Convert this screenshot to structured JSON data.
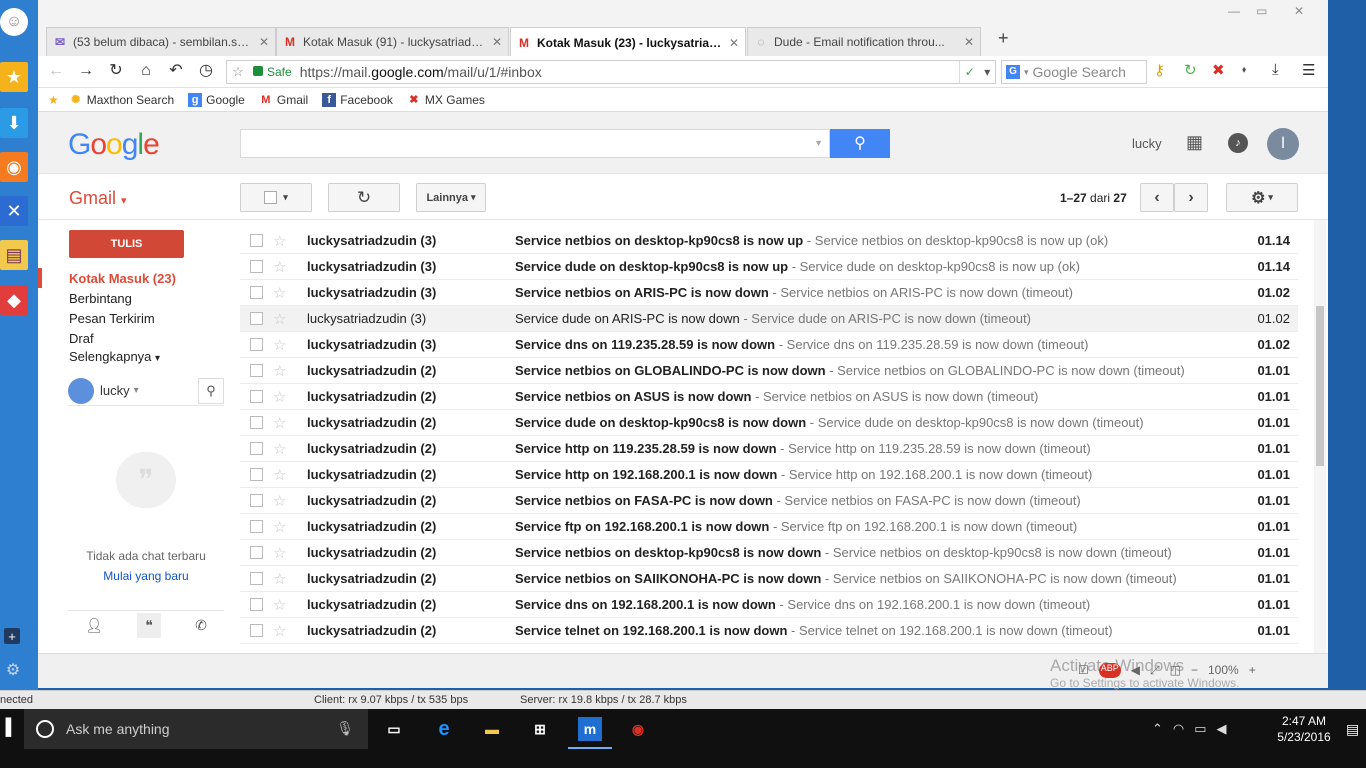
{
  "sidebar": {
    "icons": [
      "smiley-icon",
      "favorites-star-icon",
      "download-icon",
      "rss-icon",
      "tools-icon",
      "notes-icon",
      "games-icon",
      "add-icon",
      "settings-gear-icon"
    ]
  },
  "tabs": [
    {
      "label": "(53 belum dibaca) - sembilan.sut...",
      "icon": "mail-icon",
      "active": false
    },
    {
      "label": "Kotak Masuk (91) - luckysatriadz...",
      "icon": "gmail-icon",
      "active": false
    },
    {
      "label": "Kotak Masuk (23) - luckysatria1...",
      "icon": "gmail-icon",
      "active": true
    },
    {
      "label": "Dude - Email notification throu...",
      "icon": "page-icon",
      "active": false
    }
  ],
  "nav": {
    "safe_label": "Safe",
    "url_prefix": "https://mail.",
    "url_domain": "google.com",
    "url_suffix": "/mail/u/1/#inbox",
    "search_placeholder": "Google Search"
  },
  "bookmarks": [
    {
      "label": "Maxthon Search",
      "icon": "maxthon-icon",
      "color": "#f6b21a"
    },
    {
      "label": "Google",
      "icon": "google-icon",
      "color": "#4285f4"
    },
    {
      "label": "Gmail",
      "icon": "gmail-icon",
      "color": "#d93025"
    },
    {
      "label": "Facebook",
      "icon": "facebook-icon",
      "color": "#3b5998"
    },
    {
      "label": "MX Games",
      "icon": "mx-games-icon",
      "color": "#d93025"
    }
  ],
  "gmail": {
    "logo": [
      "G",
      "o",
      "o",
      "g",
      "l",
      "e"
    ],
    "user_name": "lucky",
    "avatar_letter": "l",
    "brand": "Gmail",
    "more_button": "Lainnya",
    "pager_range": "1–27",
    "pager_of": "dari",
    "pager_total": "27",
    "compose": "TULIS",
    "nav": [
      {
        "label": "Kotak Masuk (23)",
        "active": true
      },
      {
        "label": "Berbintang",
        "active": false
      },
      {
        "label": "Pesan Terkirim",
        "active": false
      },
      {
        "label": "Draf",
        "active": false
      },
      {
        "label": "Selengkapnya",
        "active": false
      }
    ],
    "hangouts_user": "lucky",
    "no_chat": "Tidak ada chat terbaru",
    "start_new": "Mulai yang baru",
    "emails": [
      {
        "sender": "luckysatriadzudin (3)",
        "subject": "Service netbios on desktop-kp90cs8 is now up",
        "snippet": " - Service netbios on desktop-kp90cs8 is now up (ok)",
        "date": "01.14",
        "read": false
      },
      {
        "sender": "luckysatriadzudin (3)",
        "subject": "Service dude on desktop-kp90cs8 is now up",
        "snippet": " - Service dude on desktop-kp90cs8 is now up (ok)",
        "date": "01.14",
        "read": false
      },
      {
        "sender": "luckysatriadzudin (3)",
        "subject": "Service netbios on ARIS-PC is now down",
        "snippet": " - Service netbios on ARIS-PC is now down (timeout)",
        "date": "01.02",
        "read": false
      },
      {
        "sender": "luckysatriadzudin (3)",
        "subject": "Service dude on ARIS-PC is now down",
        "snippet": " - Service dude on ARIS-PC is now down (timeout)",
        "date": "01.02",
        "read": true
      },
      {
        "sender": "luckysatriadzudin (3)",
        "subject": "Service dns on 119.235.28.59 is now down",
        "snippet": " - Service dns on 119.235.28.59 is now down (timeout)",
        "date": "01.02",
        "read": false
      },
      {
        "sender": "luckysatriadzudin (2)",
        "subject": "Service netbios on GLOBALINDO-PC is now down",
        "snippet": " - Service netbios on GLOBALINDO-PC is now down (timeout)",
        "date": "01.01",
        "read": false
      },
      {
        "sender": "luckysatriadzudin (2)",
        "subject": "Service netbios on ASUS is now down",
        "snippet": " - Service netbios on ASUS is now down (timeout)",
        "date": "01.01",
        "read": false
      },
      {
        "sender": "luckysatriadzudin (2)",
        "subject": "Service dude on desktop-kp90cs8 is now down",
        "snippet": " - Service dude on desktop-kp90cs8 is now down (timeout)",
        "date": "01.01",
        "read": false
      },
      {
        "sender": "luckysatriadzudin (2)",
        "subject": "Service http on 119.235.28.59 is now down",
        "snippet": " - Service http on 119.235.28.59 is now down (timeout)",
        "date": "01.01",
        "read": false
      },
      {
        "sender": "luckysatriadzudin (2)",
        "subject": "Service http on 192.168.200.1 is now down",
        "snippet": " - Service http on 192.168.200.1 is now down (timeout)",
        "date": "01.01",
        "read": false
      },
      {
        "sender": "luckysatriadzudin (2)",
        "subject": "Service netbios on FASA-PC is now down",
        "snippet": " - Service netbios on FASA-PC is now down (timeout)",
        "date": "01.01",
        "read": false
      },
      {
        "sender": "luckysatriadzudin (2)",
        "subject": "Service ftp on 192.168.200.1 is now down",
        "snippet": " - Service ftp on 192.168.200.1 is now down (timeout)",
        "date": "01.01",
        "read": false
      },
      {
        "sender": "luckysatriadzudin (2)",
        "subject": "Service netbios on desktop-kp90cs8 is now down",
        "snippet": " - Service netbios on desktop-kp90cs8 is now down (timeout)",
        "date": "01.01",
        "read": false
      },
      {
        "sender": "luckysatriadzudin (2)",
        "subject": "Service netbios on SAIIKONOHA-PC is now down",
        "snippet": " - Service netbios on SAIIKONOHA-PC is now down (timeout)",
        "date": "01.01",
        "read": false
      },
      {
        "sender": "luckysatriadzudin (2)",
        "subject": "Service dns on 192.168.200.1 is now down",
        "snippet": " - Service dns on 192.168.200.1 is now down (timeout)",
        "date": "01.01",
        "read": false
      },
      {
        "sender": "luckysatriadzudin (2)",
        "subject": "Service telnet on 192.168.200.1 is now down",
        "snippet": " - Service telnet on 192.168.200.1 is now down (timeout)",
        "date": "01.01",
        "read": false
      }
    ]
  },
  "status": {
    "activate_title": "Activate Windows",
    "activate_sub": "Go to Settings to activate Windows.",
    "zoom": "100%"
  },
  "netbar": {
    "left": "nected",
    "client": "Client: rx 9.07 kbps / tx 535 bps",
    "server": "Server: rx 19.8 kbps / tx 28.7 kbps"
  },
  "taskbar": {
    "search_placeholder": "Ask me anything",
    "time": "2:47 AM",
    "date": "5/23/2016"
  }
}
